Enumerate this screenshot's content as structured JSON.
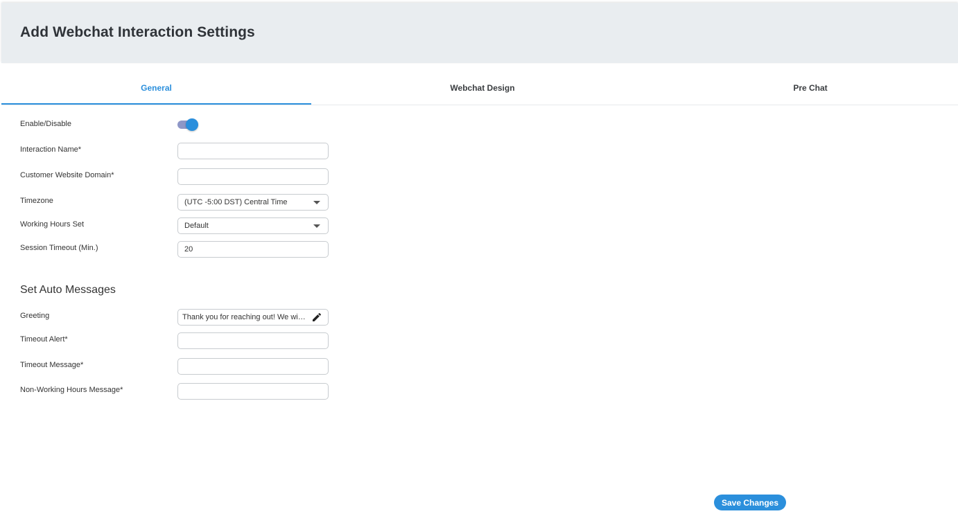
{
  "header": {
    "title": "Add Webchat Interaction Settings"
  },
  "tabs": [
    {
      "label": "General",
      "active": true
    },
    {
      "label": "Webchat Design",
      "active": false
    },
    {
      "label": "Pre Chat",
      "active": false
    }
  ],
  "general": {
    "enable": {
      "label": "Enable/Disable",
      "on": true
    },
    "interaction_name": {
      "label": "Interaction Name*",
      "value": ""
    },
    "website_domain": {
      "label": "Customer Website Domain*",
      "value": ""
    },
    "timezone": {
      "label": "Timezone",
      "selected": "(UTC -5:00 DST) Central Time"
    },
    "working_hours": {
      "label": "Working Hours Set",
      "selected": "Default"
    },
    "session_timeout": {
      "label": "Session Timeout (Min.)",
      "value": "20"
    }
  },
  "auto_messages": {
    "section_title": "Set Auto Messages",
    "greeting": {
      "label": "Greeting",
      "value": "Thank you for reaching out! We will be with you shortly."
    },
    "timeout_alert": {
      "label": "Timeout Alert*",
      "value": ""
    },
    "timeout_message": {
      "label": "Timeout Message*",
      "value": ""
    },
    "non_working_message": {
      "label": "Non-Working Hours Message*",
      "value": ""
    }
  },
  "footer": {
    "save_label": "Save Changes"
  },
  "colors": {
    "accent": "#2b8fdc",
    "header_bg": "#e9edf0",
    "toggle_track": "#8e97c7"
  },
  "icons": {
    "greeting_edit": "pencil-icon",
    "dropdown": "chevron-down-icon"
  }
}
